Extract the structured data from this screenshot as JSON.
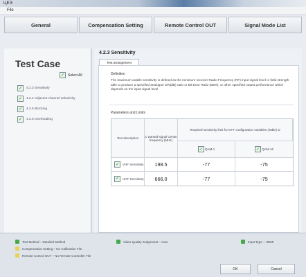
{
  "window": {
    "title": "ЦЕЭ"
  },
  "menu": {
    "file": "File"
  },
  "tabs": [
    {
      "label": "General"
    },
    {
      "label": "Compensation Setting"
    },
    {
      "label": "Remote Control OUT"
    },
    {
      "label": "Signal Mode List"
    }
  ],
  "left": {
    "title": "Test Case",
    "select_all": "Select All",
    "items": [
      {
        "label": "4.2.3 Sensitivity"
      },
      {
        "label": "4.2.4 Adjacent channel selectivity"
      },
      {
        "label": "4.2.5 Blocking"
      },
      {
        "label": "4.2.6 Overloading"
      }
    ]
  },
  "right": {
    "heading": "4.2.3 Sensitivity",
    "subtab": "Test arrangement",
    "definition_title": "Definition",
    "definition_text": "The maximum usable sensitivity is defined as the minimum receiver Radio Frequency (RF) input signal level or field strength able to produce a specified analogue S/N(dB) ratio or Bit Error Ratio (BER), or other specified output performance which depends on the input signal level.",
    "params_title": "Parameters and Limits",
    "table": {
      "col1": "Test description",
      "col2": "C wanted signal Center frequency (MHz)",
      "col3": "Required sensitivity limit for DTT configuration variables (Table) D",
      "sub1": "QAM-1",
      "sub2": "QAM-16",
      "rows": [
        {
          "name": "VHF Sensitivity",
          "freq": "198.5",
          "v1": "-77",
          "v2": "-75"
        },
        {
          "name": "UHF Sensitivity",
          "freq": "666.0",
          "v1": "-77",
          "v2": "-75"
        }
      ]
    }
  },
  "status": {
    "test_method": "Test Method – Detailed Method",
    "compensation": "Compensation Setting – No Calibration File",
    "remote": "Remote Control OUT – No Remote Controller File",
    "video_quality": "Video Quality Judgement – Auto",
    "input_type": "Input Type – HDMI"
  },
  "buttons": {
    "ok": "OK",
    "cancel": "Cancel"
  },
  "colors": {
    "green": "#46a84a",
    "yellow": "#e8d25a"
  }
}
